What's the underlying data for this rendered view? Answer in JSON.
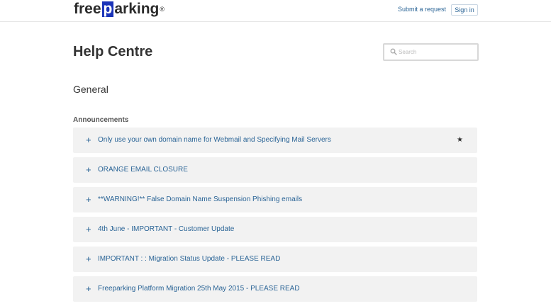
{
  "header": {
    "logo_pre": "free",
    "logo_box": "p",
    "logo_post": "arking",
    "logo_reg": "®",
    "submit_request": "Submit a request",
    "sign_in": "Sign in"
  },
  "page": {
    "title": "Help Centre",
    "search_placeholder": "Search"
  },
  "category": {
    "title": "General",
    "section": "Announcements",
    "articles": [
      {
        "label": "Only use your own domain name for Webmail and Specifying Mail Servers",
        "promoted": true
      },
      {
        "label": "ORANGE EMAIL CLOSURE",
        "promoted": false
      },
      {
        "label": "**WARNING!** False Domain Name Suspension Phishing emails",
        "promoted": false
      },
      {
        "label": "4th June - IMPORTANT - Customer Update",
        "promoted": false
      },
      {
        "label": "IMPORTANT : : Migration Status Update - PLEASE READ",
        "promoted": false
      },
      {
        "label": "Freeparking Platform Migration 25th May 2015 - PLEASE READ",
        "promoted": false
      }
    ],
    "plus_glyph": "+",
    "star_glyph": "★"
  },
  "colors": {
    "link": "#2a6496",
    "brand_box": "#1a33b8",
    "article_bg": "#f2f2f2"
  }
}
